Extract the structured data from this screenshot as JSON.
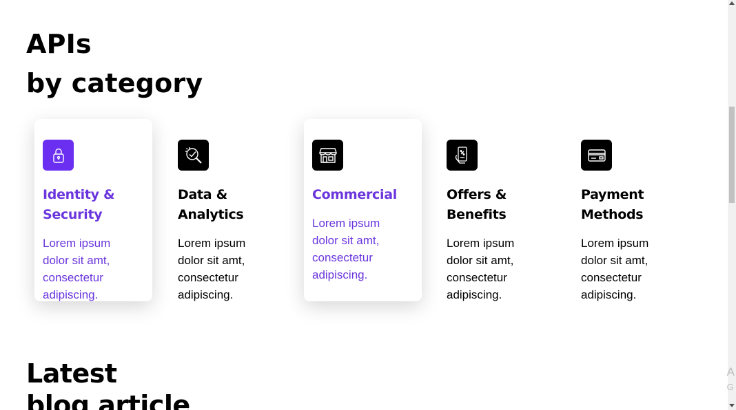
{
  "heading": {
    "line1": "APIs",
    "line2": "by category"
  },
  "categories": [
    {
      "title": "Identity & Security",
      "desc": "Lorem ipsum dolor sit amt, consectetur adipiscing.",
      "icon": "lock-icon"
    },
    {
      "title": "Data & Analytics",
      "desc": "Lorem ipsum dolor sit amt, consectetur adipiscing.",
      "icon": "analytics-search-icon"
    },
    {
      "title": "Commercial",
      "desc": "Lorem ipsum dolor sit amt, consectetur adipiscing.",
      "icon": "storefront-icon"
    },
    {
      "title": "Offers & Benefits",
      "desc": "Lorem ipsum dolor sit amt, consectetur adipiscing.",
      "icon": "mobile-offer-icon"
    },
    {
      "title": "Payment Methods",
      "desc": "Lorem ipsum dolor sit amt, consectetur adipiscing.",
      "icon": "credit-card-icon"
    }
  ],
  "blog": {
    "line1": "Latest",
    "line2": "blog article"
  },
  "watermark": {
    "line1": "A",
    "line2": "G"
  },
  "colors": {
    "accent": "#6a35dd",
    "accent_icon_bg": "#6a2ff0",
    "icon_bg": "#000000"
  }
}
